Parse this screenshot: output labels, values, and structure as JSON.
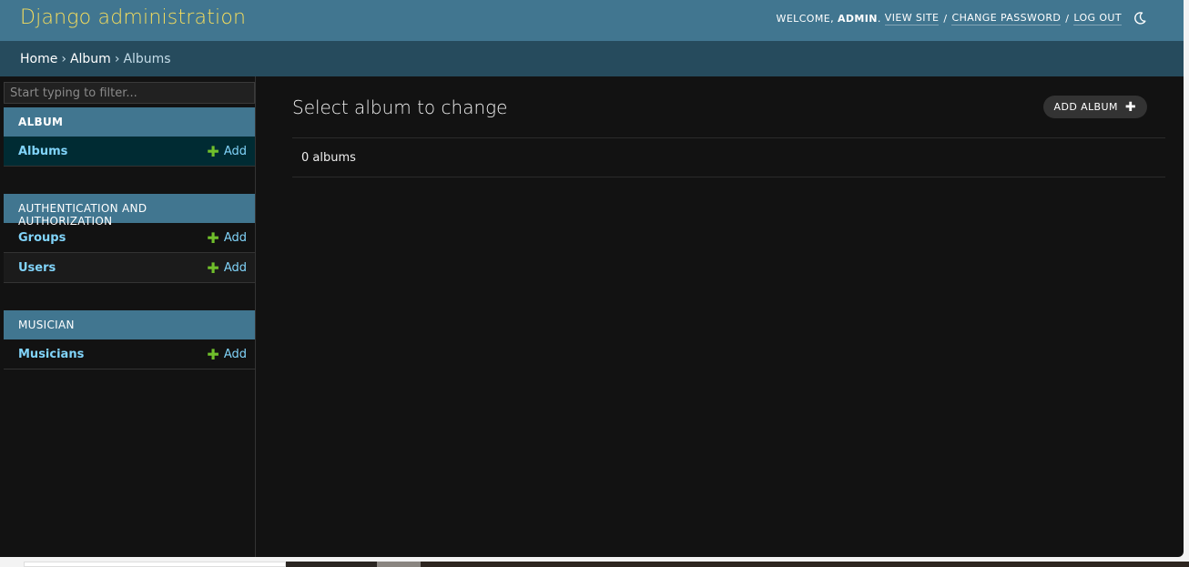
{
  "header": {
    "branding": "Django administration",
    "welcome": "WELCOME,",
    "user_name": "ADMIN",
    "user_suffix": ".",
    "view_site": "VIEW SITE",
    "change_password": "CHANGE PASSWORD",
    "log_out": "LOG OUT",
    "separator": "/",
    "theme_icon": "moon-icon"
  },
  "breadcrumbs": {
    "items": [
      "Home",
      "Album",
      "Albums"
    ],
    "separator": "›"
  },
  "sidebar": {
    "filter_placeholder": "Start typing to filter...",
    "modules": [
      {
        "caption": "ALBUM",
        "models": [
          {
            "name": "Albums",
            "add": "Add"
          }
        ]
      },
      {
        "caption": "AUTHENTICATION AND AUTHORIZATION",
        "models": [
          {
            "name": "Groups",
            "add": "Add"
          },
          {
            "name": "Users",
            "add": "Add"
          }
        ]
      },
      {
        "caption": "MUSICIAN",
        "models": [
          {
            "name": "Musicians",
            "add": "Add"
          }
        ]
      }
    ],
    "plus_glyph": "✚"
  },
  "content": {
    "title": "Select album to change",
    "add_button": "ADD ALBUM",
    "plus_glyph": "✚",
    "result_count": "0 albums"
  },
  "colors": {
    "header_bg": "#417690",
    "branding": "#f5dd5d",
    "breadcrumbs_bg": "#264b5d",
    "body_bg": "#121212",
    "link": "#81d4fa",
    "add_icon": "#70bf2b"
  }
}
